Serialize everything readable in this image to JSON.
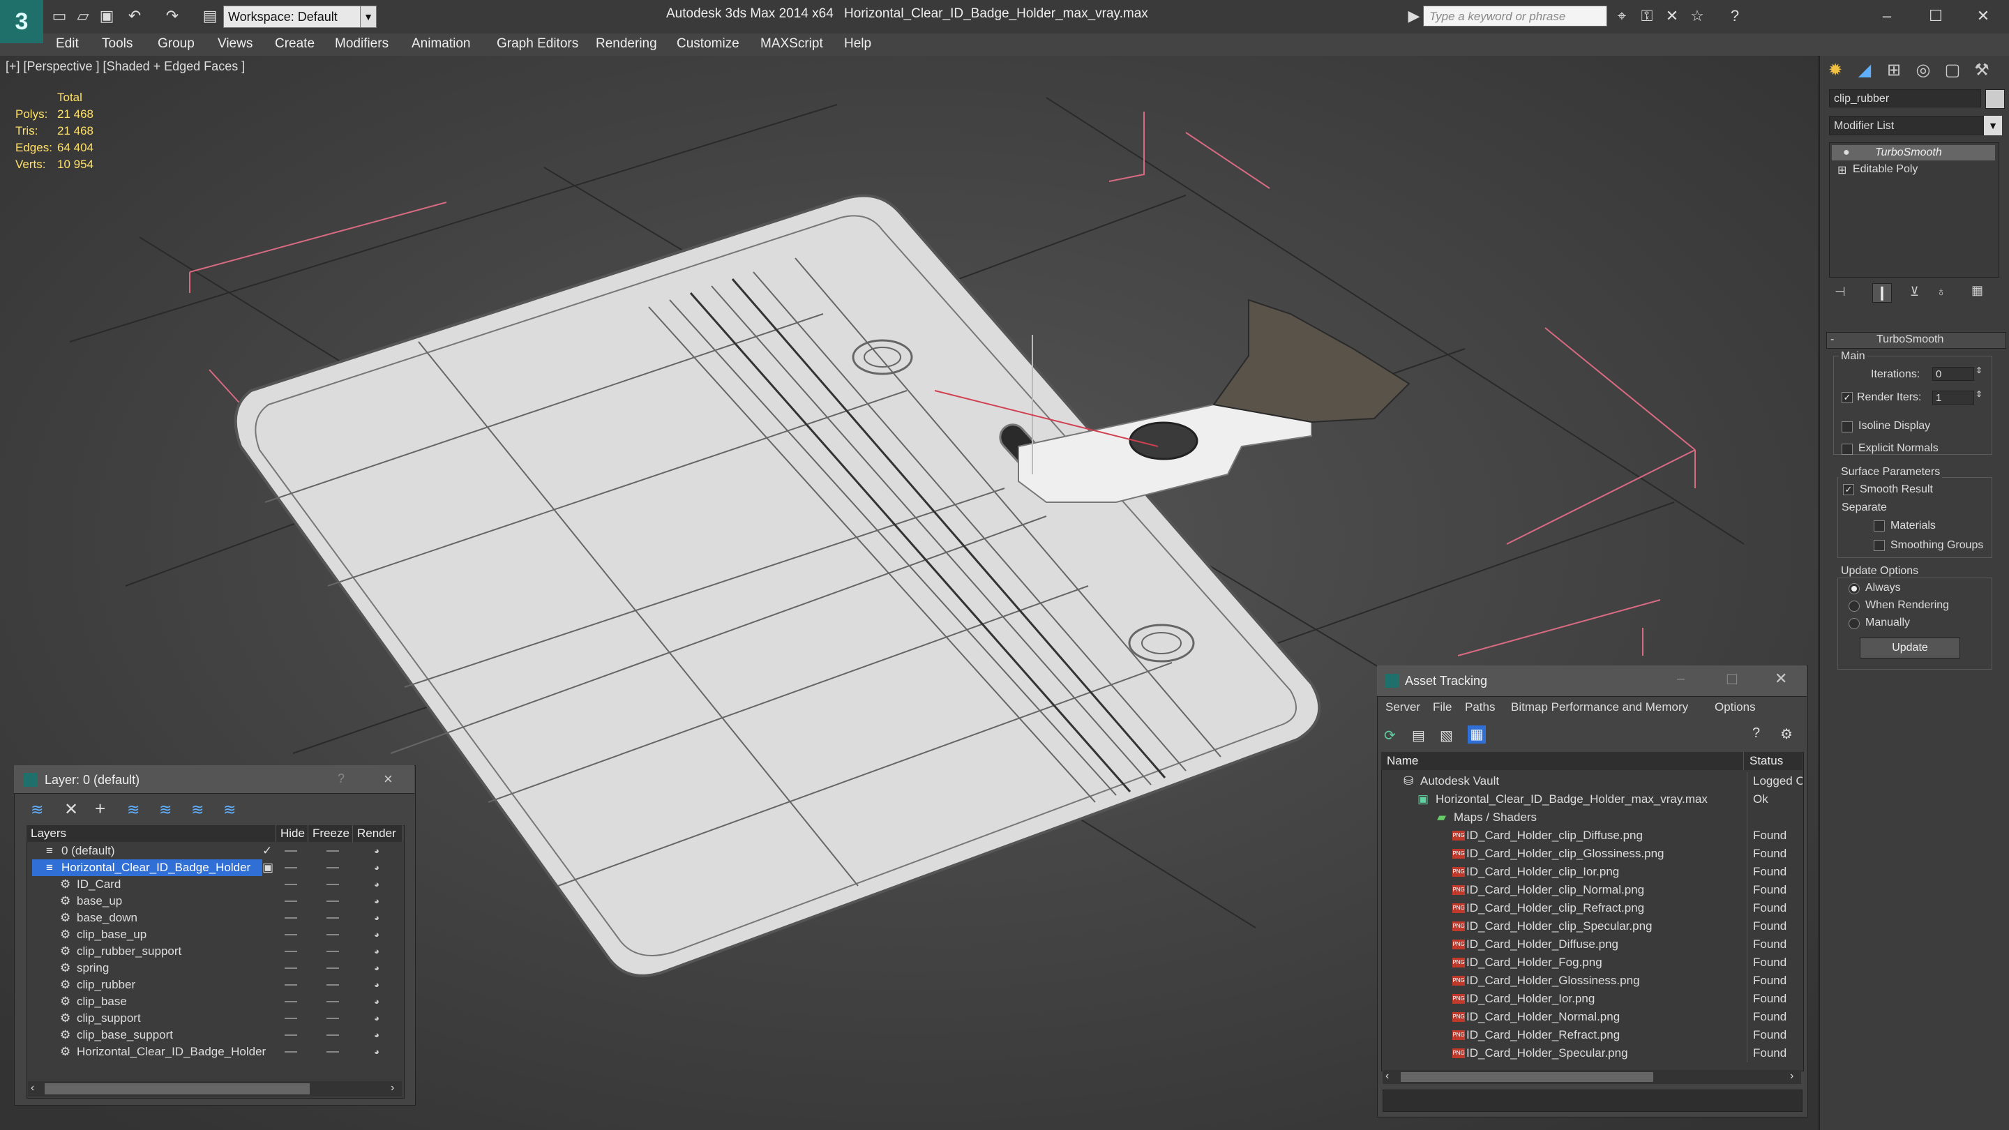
{
  "app": {
    "title": "Autodesk 3ds Max  2014 x64",
    "file": "Horizontal_Clear_ID_Badge_Holder_max_vray.max",
    "logo": "3ds-max-logo",
    "workspace": "Workspace: Default",
    "search_placeholder": "Type a keyword or phrase"
  },
  "menu": [
    "Edit",
    "Tools",
    "Group",
    "Views",
    "Create",
    "Modifiers",
    "Animation",
    "Graph Editors",
    "Rendering",
    "Customize",
    "MAXScript",
    "Help"
  ],
  "viewport": {
    "label": "[+] [Perspective ] [Shaded + Edged Faces ]",
    "stats": {
      "header": "Total",
      "rows": [
        {
          "label": "Polys:",
          "value": "21 468"
        },
        {
          "label": "Tris:",
          "value": "21 468"
        },
        {
          "label": "Edges:",
          "value": "64 404"
        },
        {
          "label": "Verts:",
          "value": "10 954"
        }
      ]
    }
  },
  "command_panel": {
    "object_name": "clip_rubber",
    "modifier_list": "Modifier List",
    "stack": [
      "TurboSmooth",
      "Editable Poly"
    ],
    "rollout_title": "TurboSmooth",
    "main_label": "Main",
    "iterations_label": "Iterations:",
    "iterations_value": "0",
    "render_iters_label": "Render Iters:",
    "render_iters_value": "1",
    "isoline": "Isoline Display",
    "explicit_normals": "Explicit Normals",
    "surface_params": "Surface Parameters",
    "smooth_result": "Smooth Result",
    "separate": "Separate",
    "materials": "Materials",
    "smoothing_groups": "Smoothing Groups",
    "update_options": "Update Options",
    "always": "Always",
    "when_rendering": "When Rendering",
    "manually": "Manually",
    "update_button": "Update"
  },
  "layer_dialog": {
    "title": "Layer: 0 (default)",
    "help": "?",
    "close": "×",
    "columns": [
      "Layers",
      "Hide",
      "Freeze",
      "Render"
    ],
    "rows": [
      {
        "name": "0 (default)",
        "level": 0
      },
      {
        "name": "Horizontal_Clear_ID_Badge_Holder",
        "level": 0
      },
      {
        "name": "ID_Card",
        "level": 1
      },
      {
        "name": "base_up",
        "level": 1
      },
      {
        "name": "base_down",
        "level": 1
      },
      {
        "name": "clip_base_up",
        "level": 1
      },
      {
        "name": "clip_rubber_support",
        "level": 1
      },
      {
        "name": "spring",
        "level": 1
      },
      {
        "name": "clip_rubber",
        "level": 1
      },
      {
        "name": "clip_base",
        "level": 1
      },
      {
        "name": "clip_support",
        "level": 1
      },
      {
        "name": "clip_base_support",
        "level": 1
      },
      {
        "name": "Horizontal_Clear_ID_Badge_Holder",
        "level": 1
      }
    ]
  },
  "asset_dialog": {
    "title": "Asset Tracking",
    "menu": [
      "Server",
      "File",
      "Paths",
      "Bitmap Performance and Memory",
      "Options"
    ],
    "col_name": "Name",
    "col_status": "Status",
    "rows": [
      {
        "name": "Autodesk Vault",
        "status": "Logged Out",
        "indent": 0,
        "icon": "vault"
      },
      {
        "name": "Horizontal_Clear_ID_Badge_Holder_max_vray.max",
        "status": "Ok",
        "indent": 1,
        "icon": "max"
      },
      {
        "name": "Maps / Shaders",
        "status": "",
        "indent": 2,
        "icon": "folder"
      },
      {
        "name": "ID_Card_Holder_clip_Diffuse.png",
        "status": "Found",
        "indent": 3,
        "icon": "png"
      },
      {
        "name": "ID_Card_Holder_clip_Glossiness.png",
        "status": "Found",
        "indent": 3,
        "icon": "png"
      },
      {
        "name": "ID_Card_Holder_clip_Ior.png",
        "status": "Found",
        "indent": 3,
        "icon": "png"
      },
      {
        "name": "ID_Card_Holder_clip_Normal.png",
        "status": "Found",
        "indent": 3,
        "icon": "png"
      },
      {
        "name": "ID_Card_Holder_clip_Refract.png",
        "status": "Found",
        "indent": 3,
        "icon": "png"
      },
      {
        "name": "ID_Card_Holder_clip_Specular.png",
        "status": "Found",
        "indent": 3,
        "icon": "png"
      },
      {
        "name": "ID_Card_Holder_Diffuse.png",
        "status": "Found",
        "indent": 3,
        "icon": "png"
      },
      {
        "name": "ID_Card_Holder_Fog.png",
        "status": "Found",
        "indent": 3,
        "icon": "png"
      },
      {
        "name": "ID_Card_Holder_Glossiness.png",
        "status": "Found",
        "indent": 3,
        "icon": "png"
      },
      {
        "name": "ID_Card_Holder_Ior.png",
        "status": "Found",
        "indent": 3,
        "icon": "png"
      },
      {
        "name": "ID_Card_Holder_Normal.png",
        "status": "Found",
        "indent": 3,
        "icon": "png"
      },
      {
        "name": "ID_Card_Holder_Refract.png",
        "status": "Found",
        "indent": 3,
        "icon": "png"
      },
      {
        "name": "ID_Card_Holder_Specular.png",
        "status": "Found",
        "indent": 3,
        "icon": "png"
      }
    ]
  },
  "colors": {
    "selection": "#2f6fd6",
    "viewport_bg": "#464646",
    "stat_text": "#ffe066"
  }
}
